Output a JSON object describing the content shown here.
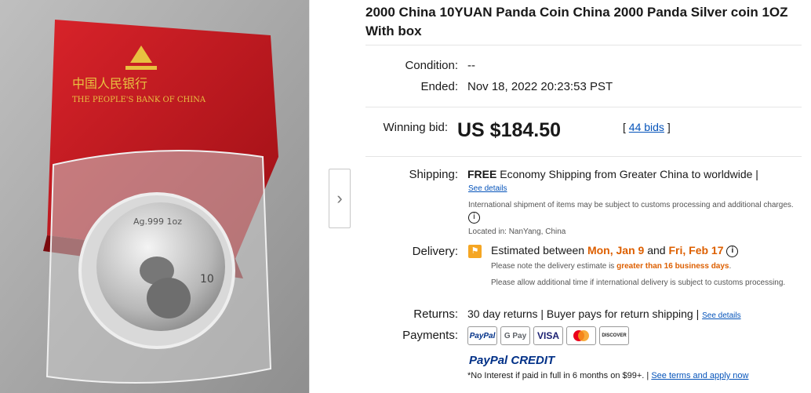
{
  "item": {
    "title": "2000 China 10YUAN Panda Coin China 2000 Panda Silver coin 1OZ With box",
    "condition_label": "Condition:",
    "condition_value": "--",
    "ended_label": "Ended:",
    "ended_value": "Nov 18, 2022 20:23:53 PST"
  },
  "bid": {
    "label": "Winning bid:",
    "price": "US $184.50",
    "bids_open": "[",
    "bids_link": "44 bids",
    "bids_close": "]"
  },
  "shipping": {
    "label": "Shipping:",
    "free": "FREE",
    "text": "Economy Shipping from Greater China to worldwide |",
    "see_details": "See details",
    "note": "International shipment of items may be subject to customs processing and additional charges.",
    "location": "Located in: NanYang, China"
  },
  "delivery": {
    "label": "Delivery:",
    "prefix": "Estimated between",
    "start": "Mon, Jan 9",
    "and": "and",
    "end": "Fri, Feb 17",
    "note1_prefix": "Please note the delivery estimate is",
    "note1_highlight": "greater than 16 business days",
    "note1_suffix": ".",
    "note2": "Please allow additional time if international delivery is subject to customs processing."
  },
  "returns": {
    "label": "Returns:",
    "text": "30 day returns | Buyer pays for return shipping |",
    "see_details": "See details"
  },
  "payments": {
    "label": "Payments:",
    "methods": [
      "PayPal",
      "G Pay",
      "VISA",
      "MC",
      "DISCOVER"
    ],
    "paypal_credit": "PayPal CREDIT",
    "credit_note": "*No Interest if paid in full in 6 months on $99+. |",
    "credit_link": "See terms and apply now"
  },
  "image": {
    "box_text_cn": "中国人民银行",
    "box_text_en": "THE PEOPLE'S BANK OF CHINA",
    "coin_text": "Ag.999 1oz",
    "coin_value": "10"
  },
  "colors": {
    "accent_orange": "#dd5f00",
    "link_blue": "#0654ba",
    "box_red": "#c8161d"
  }
}
